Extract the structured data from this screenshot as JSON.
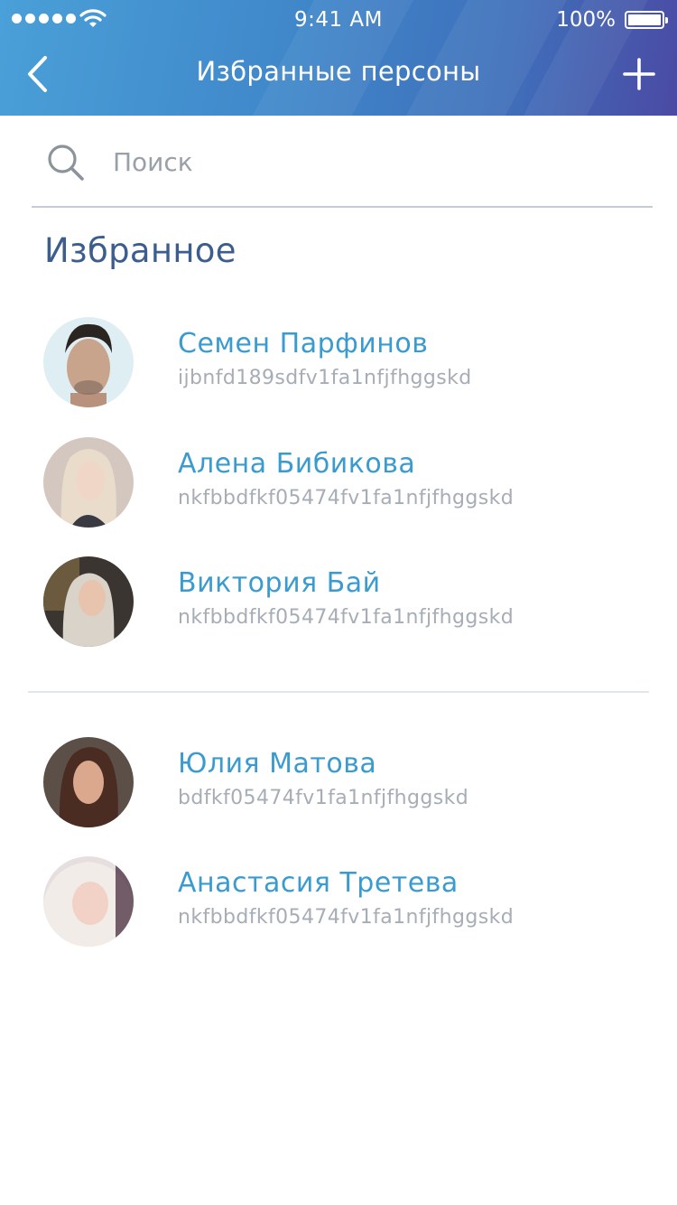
{
  "status_bar": {
    "time": "9:41 AM",
    "battery": "100%"
  },
  "nav": {
    "title": "Избранные персоны",
    "back_icon": "chevron-left-icon",
    "add_icon": "plus-icon"
  },
  "search": {
    "placeholder": "Поиск",
    "icon": "search-icon"
  },
  "favorites": {
    "title": "Избранное",
    "items": [
      {
        "name": "Семен Парфинов",
        "id": "ijbnfd189sdfv1fa1nfjfhggskd"
      },
      {
        "name": "Алена Бибикова",
        "id": "nkfbbdfkf05474fv1fa1nfjfhggskd"
      },
      {
        "name": "Виктория Бай",
        "id": "nkfbbdfkf05474fv1fa1nfjfhggskd"
      }
    ]
  },
  "others": {
    "items": [
      {
        "name": "Юлия Матова",
        "id": "bdfkf05474fv1fa1nfjfhggskd"
      },
      {
        "name": "Анастасия Третева",
        "id": "nkfbbdfkf05474fv1fa1nfjfhggskd"
      }
    ]
  },
  "colors": {
    "accent": "#3a9bd0",
    "section_title": "#3c5d8e",
    "subtitle": "#a7adb6"
  }
}
